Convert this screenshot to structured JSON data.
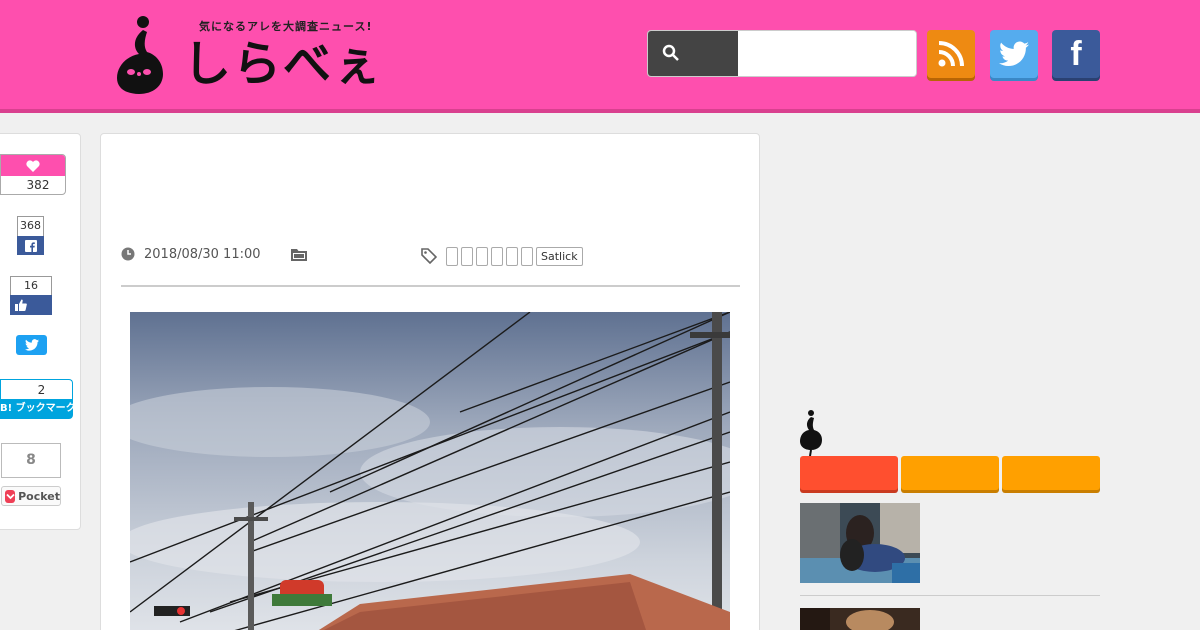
{
  "header": {
    "tagline": "気になるアレを大調査ニュース!",
    "logo_text": "しらべぇ",
    "colors": {
      "brand": "#fe4fae",
      "rss": "#ee8a12",
      "twitter": "#55acee",
      "facebook": "#3b5a9a"
    },
    "search": {
      "placeholder": "",
      "value": ""
    },
    "icons": [
      "search-icon",
      "rss-icon",
      "twitter-icon",
      "facebook-icon"
    ],
    "facebook_letter": "f"
  },
  "share": {
    "likes": "382",
    "facebook_count": "368",
    "fb_like_count": "16",
    "hatena_count": "2",
    "hatena_label": "B! ブックマーク",
    "pocket_count": "8",
    "pocket_label": "Pocket"
  },
  "article": {
    "date": "2018/08/30 11:00",
    "tags": [
      "",
      "",
      "",
      "",
      "",
      "",
      "Satlick"
    ]
  },
  "sidebar": {
    "tab_colors": [
      "#ff4f2f",
      "#ffa000",
      "#ffa000"
    ]
  }
}
